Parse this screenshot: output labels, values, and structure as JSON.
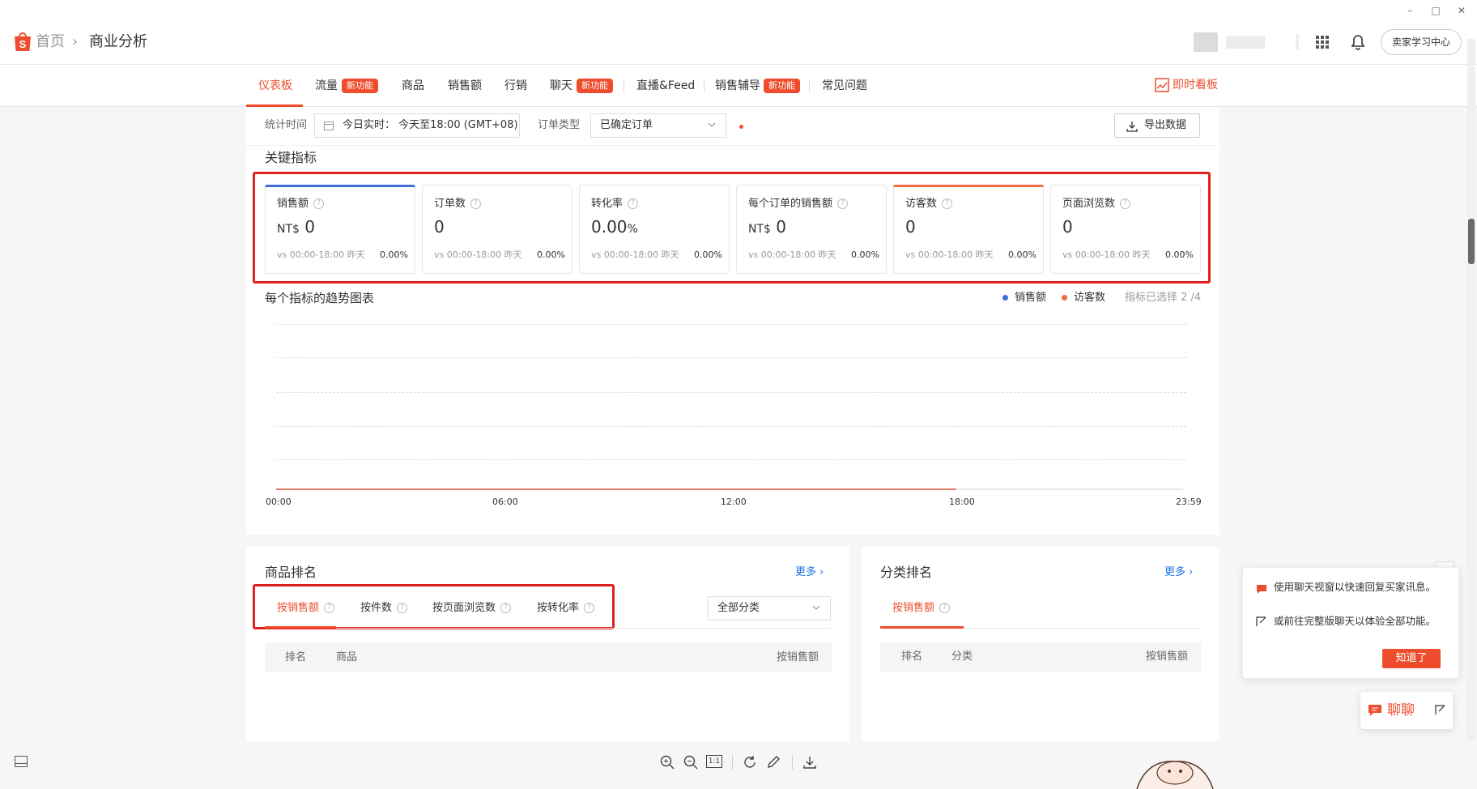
{
  "window": {
    "minimize": "–",
    "maximize": "□",
    "close": "✕"
  },
  "header": {
    "breadcrumb_home": "首页",
    "breadcrumb_sep": "›",
    "breadcrumb_current": "商业分析",
    "seller_center_label": "卖家学习中心"
  },
  "nav": {
    "tabs": [
      {
        "label": "仪表板"
      },
      {
        "label": "流量",
        "badge": "新功能"
      },
      {
        "label": "商品"
      },
      {
        "label": "销售额"
      },
      {
        "label": "行销"
      },
      {
        "label": "聊天",
        "badge": "新功能"
      },
      {
        "label": "直播&Feed"
      },
      {
        "label": "销售辅导",
        "badge": "新功能"
      },
      {
        "label": "常见问题"
      }
    ],
    "realtime_label": "即时看板"
  },
  "filters": {
    "time_label": "统计时间",
    "time_value": "今日实时： 今天至18:00 (GMT+08)",
    "order_type_label": "订单类型",
    "order_type_value": "已确定订单",
    "export_label": "导出数据"
  },
  "key_metrics": {
    "title": "关键指标",
    "cards": [
      {
        "title": "销售额",
        "prefix": "NT$",
        "value": "0",
        "compare": "vs 00:00-18:00 昨天",
        "change": "0.00%",
        "accent": "#3d6fd8"
      },
      {
        "title": "订单数",
        "prefix": "",
        "value": "0",
        "compare": "vs 00:00-18:00 昨天",
        "change": "0.00%",
        "accent": ""
      },
      {
        "title": "转化率",
        "prefix": "",
        "value": "0.00",
        "suffix": "%",
        "compare": "vs 00:00-18:00 昨天",
        "change": "0.00%",
        "accent": ""
      },
      {
        "title": "每个订单的销售额",
        "prefix": "NT$",
        "value": "0",
        "compare": "vs 00:00-18:00 昨天",
        "change": "0.00%",
        "accent": ""
      },
      {
        "title": "访客数",
        "prefix": "",
        "value": "0",
        "compare": "vs 00:00-18:00 昨天",
        "change": "0.00%",
        "accent": "#ee6a3f"
      },
      {
        "title": "页面浏览数",
        "prefix": "",
        "value": "0",
        "compare": "vs 00:00-18:00 昨天",
        "change": "0.00%",
        "accent": ""
      }
    ]
  },
  "trend": {
    "title": "每个指标的趋势图表",
    "legend": [
      {
        "name": "销售额",
        "color": "#3d6fd8"
      },
      {
        "name": "访客数",
        "color": "#ee6a3f"
      }
    ],
    "selected_count": "指标已选择 2 /4"
  },
  "chart_data": {
    "type": "line",
    "x": [
      "00:00",
      "06:00",
      "12:00",
      "18:00",
      "23:59"
    ],
    "series": [
      {
        "name": "销售额",
        "values": [
          0,
          0,
          0,
          0
        ]
      },
      {
        "name": "访客数",
        "values": [
          0,
          0,
          0,
          0
        ]
      }
    ],
    "grid": true,
    "legend": "top-right"
  },
  "product_ranking": {
    "title": "商品排名",
    "more": "更多",
    "tabs": [
      "按销售额",
      "按件数",
      "按页面浏览数",
      "按转化率"
    ],
    "category_select": "全部分类",
    "columns": [
      "排名",
      "商品",
      "按销售额"
    ]
  },
  "category_ranking": {
    "title": "分类排名",
    "more": "更多",
    "tab": "按销售额",
    "columns": [
      "排名",
      "分类",
      "按销售额"
    ]
  },
  "chat_popup": {
    "line1": "使用聊天视窗以快速回复买家讯息。",
    "line2": "或前往完整版聊天以体验全部功能。",
    "button": "知道了",
    "chat_label": "聊聊"
  },
  "viewer": {
    "fit_label": "1:1"
  }
}
